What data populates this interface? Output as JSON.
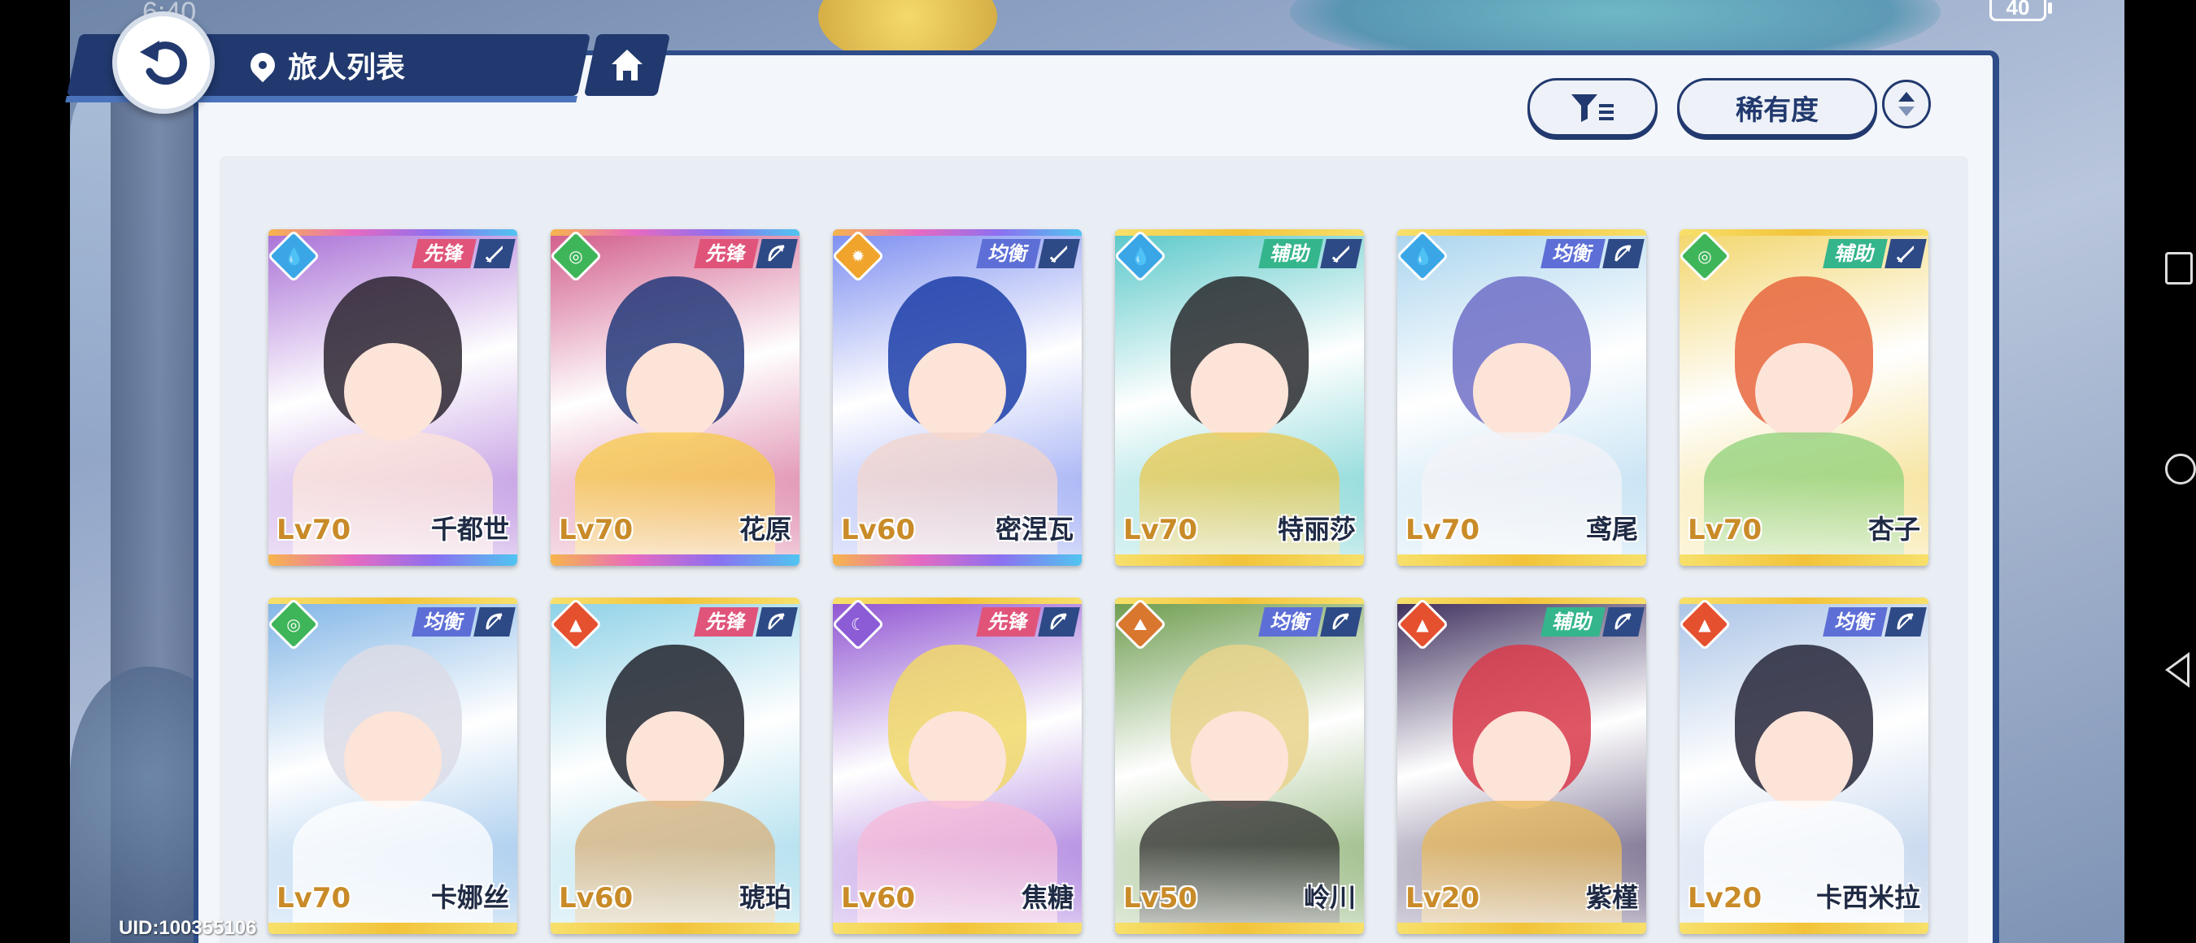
{
  "status": {
    "clock": "6:40",
    "battery": "40"
  },
  "header": {
    "title": "旅人列表"
  },
  "controls": {
    "sort_label": "稀有度"
  },
  "uid": "UID:100355106",
  "colors": {
    "navy": "#21396e",
    "role_vanguard": "#e0547a",
    "role_balance": "#5d6fd6",
    "role_support": "#35b58c",
    "rarity_gold": "#f4d24a",
    "rarity_rainbow": "#b58cf0"
  },
  "cards": [
    {
      "name": "千都世",
      "level": "Lv70",
      "role": "先锋",
      "element": "water",
      "element_icon": "water-drop-icon",
      "weapon_icon": "sword-icon",
      "rarity": "rainbow",
      "palette": [
        "#2b2530",
        "#a86fd6",
        "#fde4d8"
      ]
    },
    {
      "name": "花原",
      "level": "Lv70",
      "role": "先锋",
      "element": "wind",
      "element_icon": "wind-swirl-icon",
      "weapon_icon": "bow-icon",
      "rarity": "rainbow",
      "palette": [
        "#243a7a",
        "#d15a8a",
        "#f7c94a"
      ]
    },
    {
      "name": "密涅瓦",
      "level": "Lv60",
      "role": "均衡",
      "element": "light",
      "element_icon": "sun-icon",
      "weapon_icon": "sword-icon",
      "rarity": "rainbow",
      "palette": [
        "#1c3ea8",
        "#7a8cf0",
        "#f3d4cc"
      ]
    },
    {
      "name": "特丽莎",
      "level": "Lv70",
      "role": "辅助",
      "element": "water",
      "element_icon": "water-drop-icon",
      "weapon_icon": "sword-icon",
      "rarity": "gold",
      "palette": [
        "#2a2b2f",
        "#57c7c8",
        "#e8c84d"
      ]
    },
    {
      "name": "鸢尾",
      "level": "Lv70",
      "role": "均衡",
      "element": "water",
      "element_icon": "water-drop-icon",
      "weapon_icon": "bow-icon",
      "rarity": "gold",
      "palette": [
        "#6e6ec7",
        "#a9d4ee",
        "#f3f3f7"
      ]
    },
    {
      "name": "杏子",
      "level": "Lv70",
      "role": "辅助",
      "element": "wind",
      "element_icon": "wind-swirl-icon",
      "weapon_icon": "sword-icon",
      "rarity": "gold",
      "palette": [
        "#e8663e",
        "#f2d56a",
        "#8fd17a"
      ]
    },
    {
      "name": "卡娜丝",
      "level": "Lv70",
      "role": "均衡",
      "element": "wind",
      "element_icon": "wind-swirl-icon",
      "weapon_icon": "bow-icon",
      "rarity": "gold",
      "palette": [
        "#dcdce6",
        "#7fb4e6",
        "#ffffff"
      ]
    },
    {
      "name": "琥珀",
      "level": "Lv60",
      "role": "先锋",
      "element": "fire",
      "element_icon": "flame-icon",
      "weapon_icon": "bow-icon",
      "rarity": "gold",
      "palette": [
        "#22252e",
        "#8ad0e6",
        "#d7b07a"
      ]
    },
    {
      "name": "焦糖",
      "level": "Lv60",
      "role": "先锋",
      "element": "dark",
      "element_icon": "moon-icon",
      "weapon_icon": "bow-icon",
      "rarity": "gold",
      "palette": [
        "#f1d86a",
        "#8c4fd1",
        "#f6b9d8"
      ]
    },
    {
      "name": "岭川",
      "level": "Lv50",
      "role": "均衡",
      "element": "earth",
      "element_icon": "mountain-icon",
      "weapon_icon": "bow-icon",
      "rarity": "gold",
      "palette": [
        "#e9d38c",
        "#6a9a4a",
        "#2d2d2d"
      ]
    },
    {
      "name": "紫槿",
      "level": "Lv20",
      "role": "辅助",
      "element": "fire",
      "element_icon": "flame-icon",
      "weapon_icon": "bow-icon",
      "rarity": "gold",
      "palette": [
        "#d93a4a",
        "#3a2a5a",
        "#e7b85a"
      ]
    },
    {
      "name": "卡西米拉",
      "level": "Lv20",
      "role": "均衡",
      "element": "fire",
      "element_icon": "flame-icon",
      "weapon_icon": "bow-icon",
      "rarity": "gold",
      "palette": [
        "#262638",
        "#a9c3e6",
        "#ffffff"
      ]
    }
  ]
}
